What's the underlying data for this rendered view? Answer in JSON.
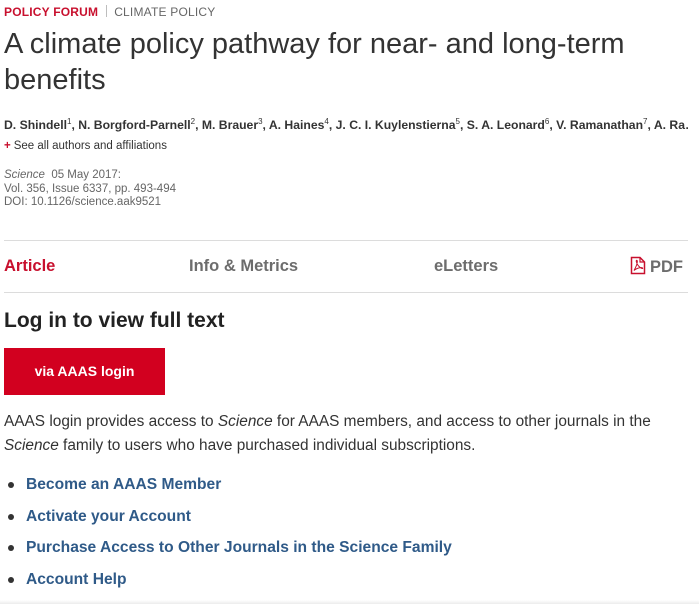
{
  "header": {
    "category_primary": "POLICY FORUM",
    "category_secondary": "CLIMATE POLICY"
  },
  "article": {
    "title": "A climate policy pathway for near- and long-term benefits",
    "authors": [
      {
        "name": "D. Shindell",
        "sup": "1"
      },
      {
        "name": "N. Borgford-Parnell",
        "sup": "2"
      },
      {
        "name": "M. Brauer",
        "sup": "3"
      },
      {
        "name": "A. Haines",
        "sup": "4"
      },
      {
        "name": "J. C. I. Kuylenstierna",
        "sup": "5"
      },
      {
        "name": "S. A. Leonard",
        "sup": "6"
      },
      {
        "name": "V. Ramanathan",
        "sup": "7"
      },
      {
        "name": "A. Ra…",
        "sup": ""
      }
    ],
    "see_all_label": "See all authors and affiliations",
    "citation": {
      "journal": "Science",
      "date": "05 May 2017:",
      "volume_line": "Vol. 356, Issue 6337, pp. 493-494",
      "doi_line": "DOI: 10.1126/science.aak9521"
    }
  },
  "tabs": [
    {
      "label": "Article",
      "active": true
    },
    {
      "label": "Info & Metrics",
      "active": false
    },
    {
      "label": "eLetters",
      "active": false
    },
    {
      "label": "PDF",
      "active": false,
      "icon": "pdf-icon"
    }
  ],
  "login": {
    "heading": "Log in to view full text",
    "button_label": "via AAAS login",
    "description_parts": [
      "AAAS login provides access to ",
      "Science",
      " for AAAS members, and access to other journals in the ",
      "Science",
      " family to users who have purchased individual subscriptions."
    ],
    "links": [
      "Become an AAAS Member",
      "Activate your Account",
      "Purchase Access to Other Journals in the Science Family",
      "Account Help"
    ]
  },
  "colors": {
    "accent_red": "#c8102e",
    "button_red": "#d2001f",
    "link_blue": "#2f5a88",
    "tab_gray": "#6d6d6d"
  }
}
